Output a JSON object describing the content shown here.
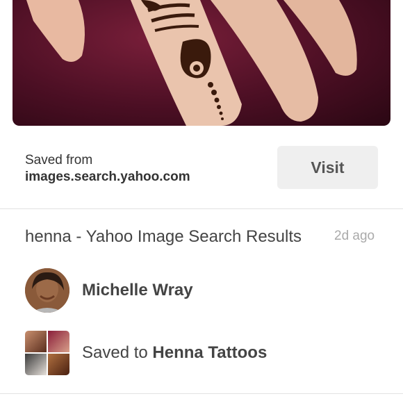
{
  "pin": {
    "saved_from_label": "Saved from",
    "source_domain": "images.search.yahoo.com",
    "visit_label": "Visit",
    "title": "henna - Yahoo Image Search Results",
    "age": "2d ago"
  },
  "pinner": {
    "name": "Michelle Wray"
  },
  "board": {
    "prefix": "Saved to",
    "name": "Henna Tattoos"
  },
  "colors": {
    "visit_button_bg": "#efefef",
    "hero_background": "#5a1229",
    "text_primary": "#444444",
    "text_muted": "#aaaaaa"
  }
}
